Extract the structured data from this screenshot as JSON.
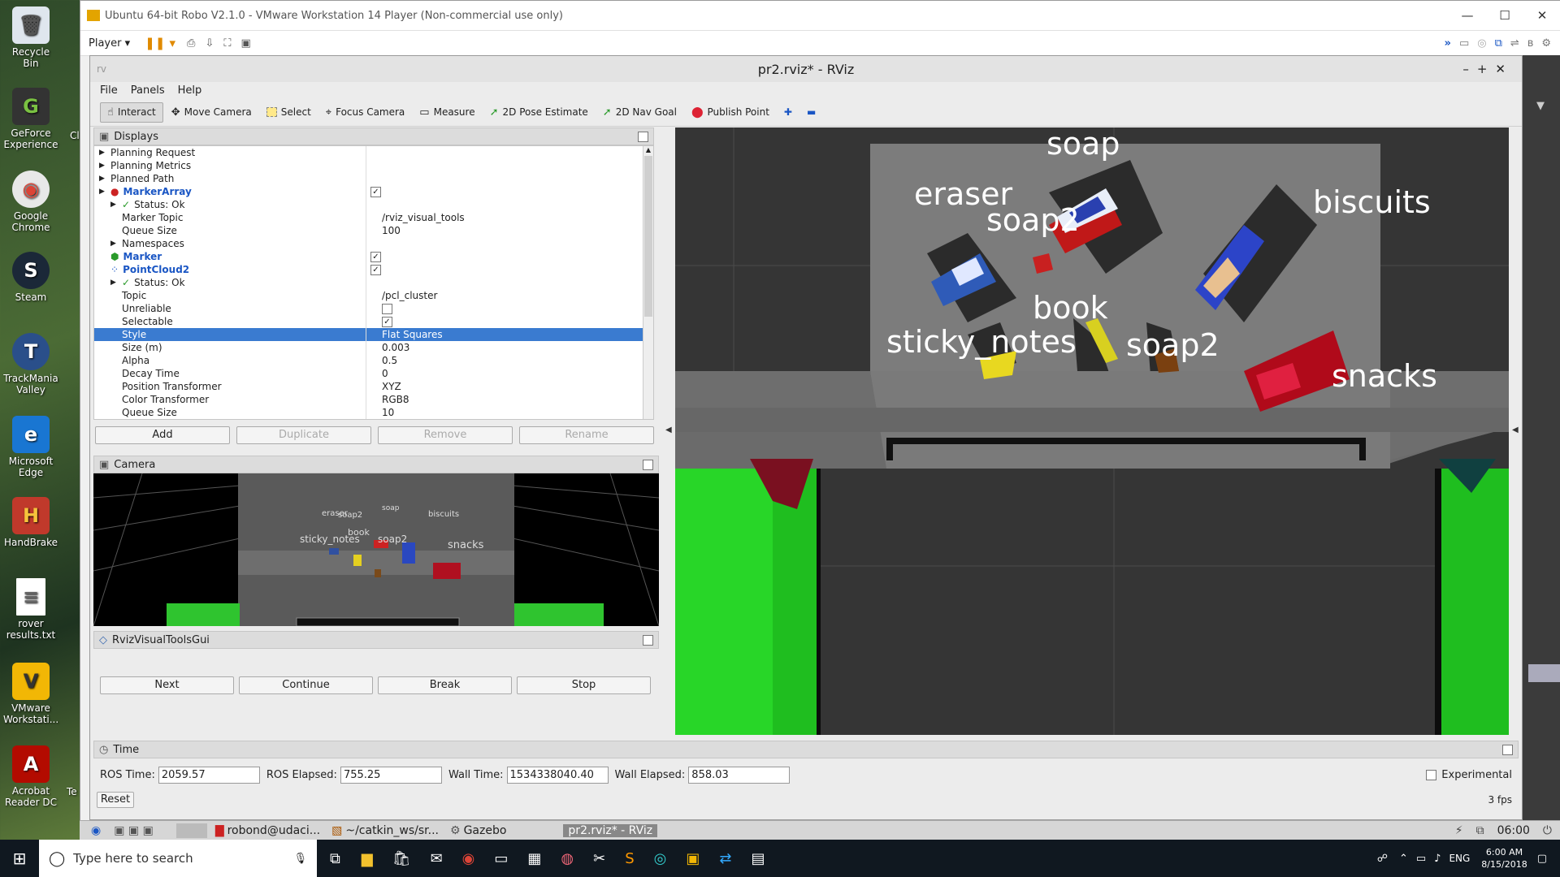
{
  "desktop": {
    "icons": [
      {
        "label": "Recycle Bin",
        "glyph": "🗑"
      },
      {
        "label": "GeForce Experience",
        "glyph": "G"
      },
      {
        "label": "Google Chrome",
        "glyph": "◉"
      },
      {
        "label": "Steam",
        "glyph": "S"
      },
      {
        "label": "TrackMania Valley",
        "glyph": "T"
      },
      {
        "label": "Microsoft Edge",
        "glyph": "e"
      },
      {
        "label": "HandBrake",
        "glyph": "H"
      },
      {
        "label": "rover results.txt",
        "glyph": "≡"
      },
      {
        "label": "VMware Workstati...",
        "glyph": "V"
      },
      {
        "label": "Acrobat Reader DC",
        "glyph": "A"
      }
    ],
    "partial_labels": [
      "Cl",
      "Te"
    ]
  },
  "vmware": {
    "title": "Ubuntu 64-bit Robo V2.1.0 - VMware Workstation 14 Player (Non-commercial use only)",
    "player_menu": "Player",
    "colors": {
      "accent": "#1a56c4"
    }
  },
  "rviz": {
    "title": "pr2.rviz* - RViz",
    "menu": [
      "File",
      "Panels",
      "Help"
    ],
    "tools": [
      {
        "label": "Interact",
        "icon": "hand-icon",
        "active": true
      },
      {
        "label": "Move Camera",
        "icon": "move-camera-icon"
      },
      {
        "label": "Select",
        "icon": "select-icon"
      },
      {
        "label": "Focus Camera",
        "icon": "focus-camera-icon"
      },
      {
        "label": "Measure",
        "icon": "measure-icon"
      },
      {
        "label": "2D Pose Estimate",
        "icon": "pose-arrow-icon"
      },
      {
        "label": "2D Nav Goal",
        "icon": "nav-arrow-icon"
      },
      {
        "label": "Publish Point",
        "icon": "pin-icon"
      }
    ],
    "displays": {
      "title": "Displays",
      "rows": [
        {
          "k": "Planning Request",
          "v": ""
        },
        {
          "k": "Planning Metrics",
          "v": ""
        },
        {
          "k": "Planned Path",
          "v": ""
        },
        {
          "k": "MarkerArray",
          "v": "✓"
        },
        {
          "k": "Status: Ok",
          "v": ""
        },
        {
          "k": "Marker Topic",
          "v": "/rviz_visual_tools"
        },
        {
          "k": "Queue Size",
          "v": "100"
        },
        {
          "k": "Namespaces",
          "v": ""
        },
        {
          "k": "Marker",
          "v": "✓"
        },
        {
          "k": "PointCloud2",
          "v": "✓"
        },
        {
          "k": "Status: Ok",
          "v": ""
        },
        {
          "k": "Topic",
          "v": "/pcl_cluster"
        },
        {
          "k": "Unreliable",
          "v": ""
        },
        {
          "k": "Selectable",
          "v": "✓"
        },
        {
          "k": "Style",
          "v": "Flat Squares"
        },
        {
          "k": "Size (m)",
          "v": "0.003"
        },
        {
          "k": "Alpha",
          "v": "0.5"
        },
        {
          "k": "Decay Time",
          "v": "0"
        },
        {
          "k": "Position Transformer",
          "v": "XYZ"
        },
        {
          "k": "Color Transformer",
          "v": "RGB8"
        },
        {
          "k": "Queue Size",
          "v": "10"
        }
      ],
      "buttons": {
        "add": "Add",
        "duplicate": "Duplicate",
        "remove": "Remove",
        "rename": "Rename"
      }
    },
    "camera": {
      "title": "Camera",
      "labels": [
        "eraser",
        "soap2",
        "soap",
        "biscuits",
        "sticky_notes",
        "book",
        "soap2",
        "snacks"
      ]
    },
    "visual_tools": {
      "title": "RvizVisualToolsGui",
      "buttons": [
        "Next",
        "Continue",
        "Break",
        "Stop"
      ]
    },
    "view3d": {
      "labels": [
        "soap",
        "eraser",
        "soap2",
        "biscuits",
        "book",
        "sticky_notes",
        "soap2",
        "snacks"
      ]
    },
    "time": {
      "title": "Time",
      "ros_time_label": "ROS Time:",
      "ros_time": "2059.57",
      "ros_elapsed_label": "ROS Elapsed:",
      "ros_elapsed": "755.25",
      "wall_time_label": "Wall Time:",
      "wall_time": "1534338040.40",
      "wall_elapsed_label": "Wall Elapsed:",
      "wall_elapsed": "858.03",
      "experimental": "Experimental",
      "reset": "Reset",
      "fps": "3 fps"
    }
  },
  "vm_taskbar": {
    "items": [
      "robond@udaci...",
      "~/catkin_ws/sr...",
      "Gazebo",
      "pr2.rviz* - RViz"
    ],
    "clock": "06:00"
  },
  "win_taskbar": {
    "search_placeholder": "Type here to search",
    "lang": "ENG",
    "time": "6:00 AM",
    "date": "8/15/2018"
  }
}
